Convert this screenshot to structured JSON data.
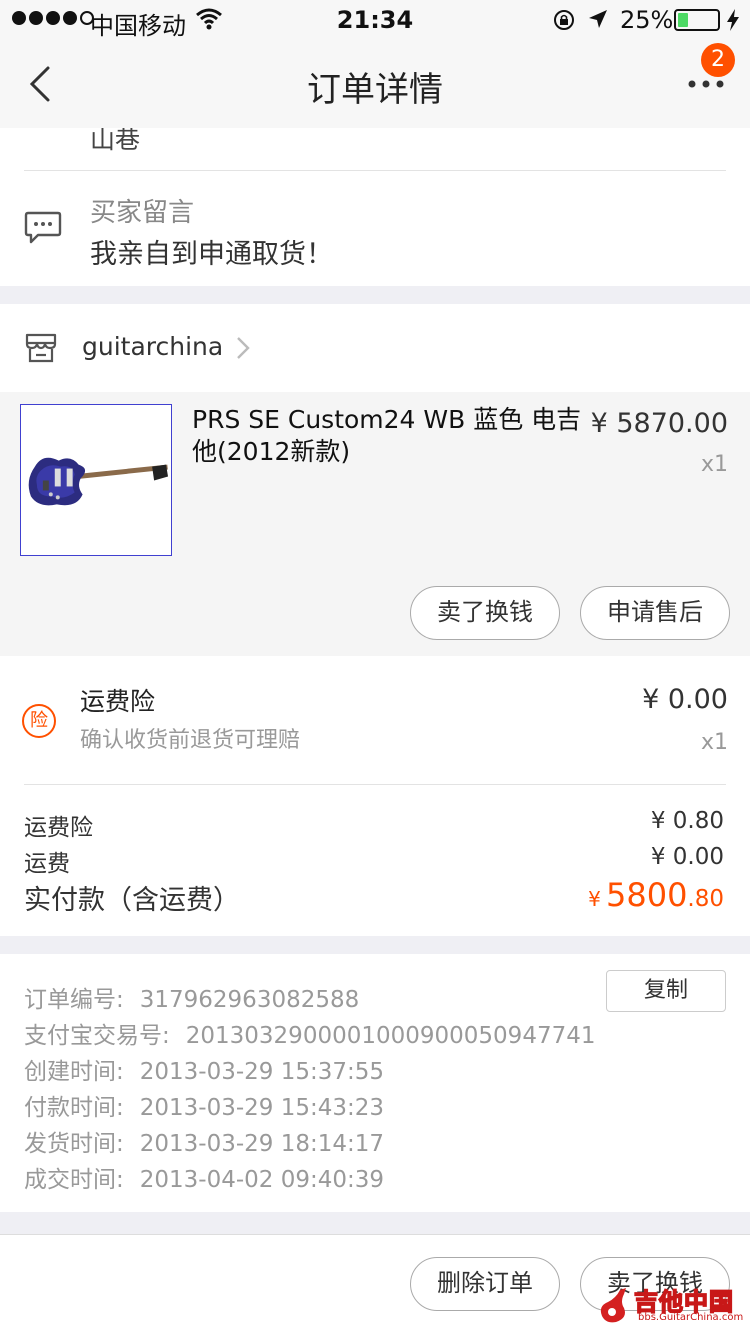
{
  "status_bar": {
    "carrier": "中国移动",
    "time": "21:34",
    "battery_percent": "25%",
    "battery_level": 0.25,
    "signal_bars_filled": 4
  },
  "nav": {
    "title": "订单详情",
    "more_badge": "2",
    "back_icon": "chevron-left-icon",
    "more_icon": "more-dots-icon"
  },
  "address": {
    "tail_text": "山巷"
  },
  "buyer_message": {
    "label": "买家留言",
    "text": "我亲自到申通取货！"
  },
  "shop": {
    "name": "guitarchina"
  },
  "item": {
    "title": "PRS SE Custom24 WB 蓝色 电吉他(2012新款)",
    "price": "¥ 5870.00",
    "quantity": "x1",
    "actions": [
      "卖了换钱",
      "申请售后"
    ]
  },
  "insurance": {
    "badge": "险",
    "name": "运费险",
    "description": "确认收货前退货可理赔",
    "price": "¥ 0.00",
    "quantity": "x1"
  },
  "summary": {
    "rows": [
      {
        "label": "运费险",
        "value": "¥ 0.80"
      },
      {
        "label": "运费",
        "value": "¥ 0.00"
      }
    ],
    "total_label": "实付款（含运费）",
    "total_currency": "¥",
    "total_integer": "5800",
    "total_decimal": ".80"
  },
  "order_info": {
    "copy_label": "复制",
    "rows": [
      {
        "label": "订单编号:",
        "value": "317962963082588"
      },
      {
        "label": "支付宝交易号:",
        "value": "2013032900001000900050947741"
      },
      {
        "label": "创建时间:",
        "value": "2013-03-29 15:37:55"
      },
      {
        "label": "付款时间:",
        "value": "2013-03-29 15:43:23"
      },
      {
        "label": "发货时间:",
        "value": "2013-03-29 18:14:17"
      },
      {
        "label": "成交时间:",
        "value": "2013-04-02 09:40:39"
      }
    ]
  },
  "bottom_bar": {
    "actions": [
      "删除订单",
      "卖了换钱"
    ]
  },
  "watermark": {
    "title": "吉他中国",
    "url": "bbs.GuitarChina.com"
  },
  "colors": {
    "accent": "#ff5000",
    "thumb_border": "#4040d0"
  }
}
